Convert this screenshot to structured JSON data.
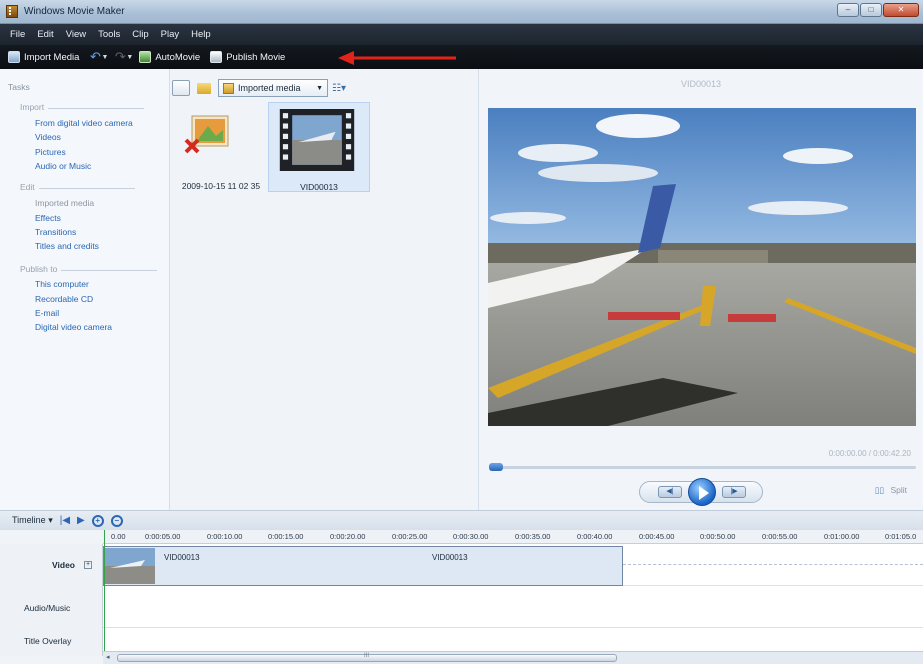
{
  "window": {
    "title": "Windows Movie Maker",
    "controls": [
      "–",
      "□",
      "✕"
    ]
  },
  "menu": [
    "File",
    "Edit",
    "View",
    "Tools",
    "Clip",
    "Play",
    "Help"
  ],
  "toolbar": {
    "import_label": "Import Media",
    "automovie_label": "AutoMovie",
    "publish_label": "Publish Movie"
  },
  "tasks": {
    "title": "Tasks",
    "sections": [
      {
        "name": "Import",
        "items": [
          "From digital video camera",
          "Videos",
          "Pictures",
          "Audio or Music"
        ]
      },
      {
        "name": "Edit",
        "items": [
          "Imported media",
          "Effects",
          "Transitions",
          "Titles and credits"
        ]
      },
      {
        "name": "Publish to",
        "items": [
          "This computer",
          "Recordable CD",
          "E-mail",
          "Digital video camera"
        ]
      }
    ]
  },
  "collection": {
    "selected_view": "Imported media",
    "clips": [
      {
        "label": "2009-10-15 11 02 35",
        "icon": "missing-image-icon"
      },
      {
        "label": "VID00013",
        "icon": "video-film-icon"
      }
    ]
  },
  "preview": {
    "title": "VID00013",
    "time": "0:00:00.00 / 0:00:42.20",
    "split_label": "Split",
    "seek_fraction": 0.0
  },
  "timeline": {
    "mode_label": "Timeline",
    "ticks": [
      "0.00",
      "0:00:05.00",
      "0:00:10.00",
      "0:00:15.00",
      "0:00:20.00",
      "0:00:25.00",
      "0:00:30.00",
      "0:00:35.00",
      "0:00:40.00",
      "0:00:45.00",
      "0:00:50.00",
      "0:00:55.00",
      "0:01:00.00",
      "0:01:05.0"
    ],
    "tracks": [
      "Video",
      "Audio/Music",
      "Title Overlay"
    ],
    "video_clip_labels": [
      "VID00013",
      "VID00013"
    ],
    "scroll_mark": "III"
  },
  "colors": {
    "accent": "#2d67b3",
    "annotation_arrow": "#e2231a",
    "menubar": "#1c242e"
  }
}
